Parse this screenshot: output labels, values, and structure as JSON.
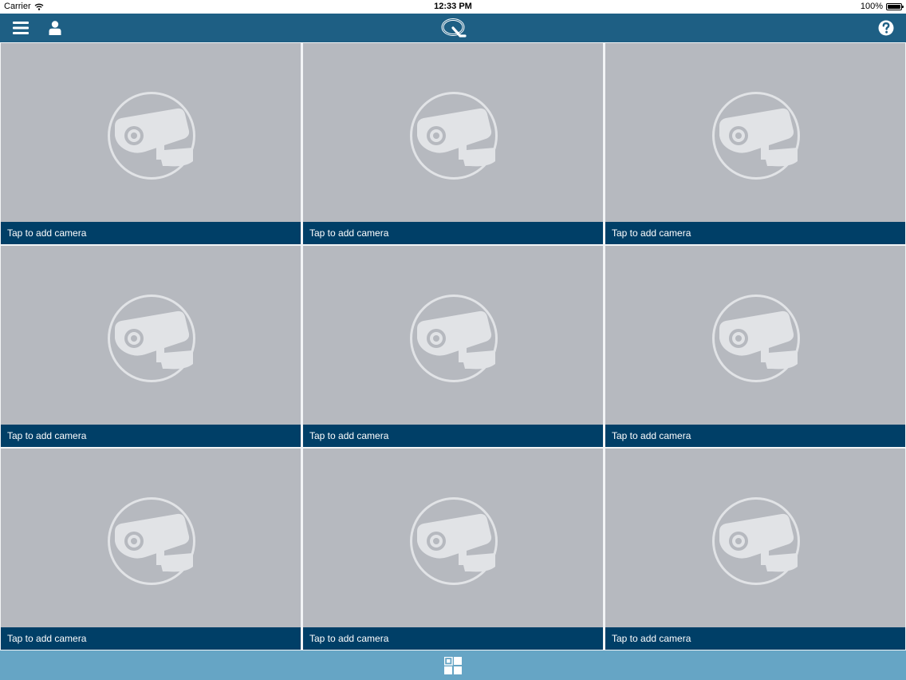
{
  "status_bar": {
    "carrier": "Carrier",
    "time": "12:33 PM",
    "battery": "100%"
  },
  "nav": {
    "menu_icon": "hamburger-menu-icon",
    "user_icon": "user-icon",
    "logo_icon": "q-logo-icon",
    "help_icon": "help-question-icon"
  },
  "grid": {
    "tiles": [
      {
        "label": "Tap to add camera"
      },
      {
        "label": "Tap to add camera"
      },
      {
        "label": "Tap to add camera"
      },
      {
        "label": "Tap to add camera"
      },
      {
        "label": "Tap to add camera"
      },
      {
        "label": "Tap to add camera"
      },
      {
        "label": "Tap to add camera"
      },
      {
        "label": "Tap to add camera"
      },
      {
        "label": "Tap to add camera"
      }
    ]
  },
  "bottom_bar": {
    "layout_icon": "grid-layout-icon"
  },
  "colors": {
    "nav_bar": "#1e5f84",
    "tile_background": "#b6b9bf",
    "label_bar": "#003f67",
    "bottom_bar": "#66a5c5"
  }
}
